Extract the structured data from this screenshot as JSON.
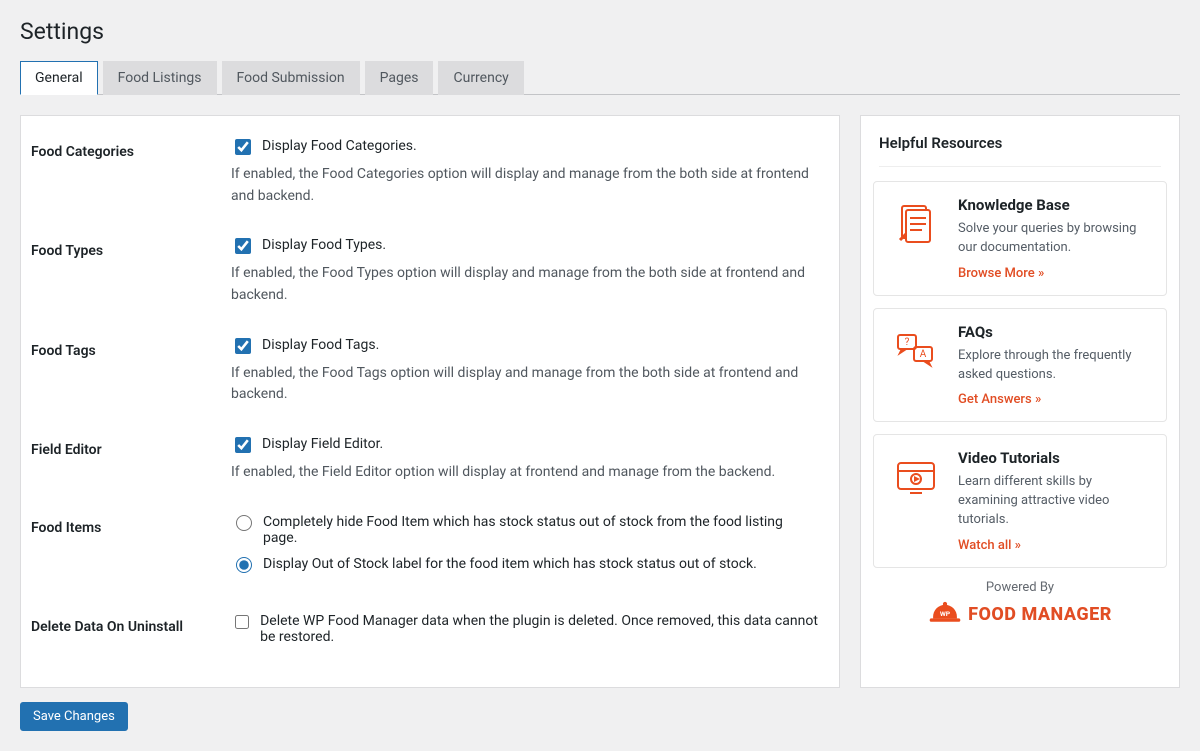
{
  "page_title": "Settings",
  "tabs": [
    "General",
    "Food Listings",
    "Food Submission",
    "Pages",
    "Currency"
  ],
  "active_tab": 0,
  "settings": [
    {
      "key": "food_categories",
      "label": "Food Categories",
      "type": "checkbox",
      "checked": true,
      "option_label": "Display Food Categories.",
      "description": "If enabled, the Food Categories option will display and manage from the both side at frontend and backend."
    },
    {
      "key": "food_types",
      "label": "Food Types",
      "type": "checkbox",
      "checked": true,
      "option_label": "Display Food Types.",
      "description": "If enabled, the Food Types option will display and manage from the both side at frontend and backend."
    },
    {
      "key": "food_tags",
      "label": "Food Tags",
      "type": "checkbox",
      "checked": true,
      "option_label": "Display Food Tags.",
      "description": "If enabled, the Food Tags option will display and manage from the both side at frontend and backend."
    },
    {
      "key": "field_editor",
      "label": "Field Editor",
      "type": "checkbox",
      "checked": true,
      "option_label": "Display Field Editor.",
      "description": "If enabled, the Field Editor option will display at frontend and manage from the backend."
    },
    {
      "key": "food_items",
      "label": "Food Items",
      "type": "radio",
      "selected": 1,
      "options": [
        "Completely hide Food Item which has stock status out of stock from the food listing page.",
        "Display Out of Stock label for the food item which has stock status out of stock."
      ]
    },
    {
      "key": "delete_data",
      "label": "Delete Data On Uninstall",
      "type": "checkbox",
      "checked": false,
      "option_label": "Delete WP Food Manager data when the plugin is deleted. Once removed, this data cannot be restored."
    }
  ],
  "save_button": "Save Changes",
  "sidebar": {
    "title": "Helpful Resources",
    "cards": [
      {
        "icon": "document-icon",
        "title": "Knowledge Base",
        "text": "Solve your queries by browsing our documentation.",
        "link_text": "Browse More »"
      },
      {
        "icon": "faq-icon",
        "title": "FAQs",
        "text": "Explore through the frequently asked questions.",
        "link_text": "Get Answers »"
      },
      {
        "icon": "video-icon",
        "title": "Video Tutorials",
        "text": "Learn different skills by examining attractive video tutorials.",
        "link_text": "Watch all »"
      }
    ],
    "powered_by": "Powered By",
    "logo_text": "FOOD MANAGER",
    "logo_badge": "WP"
  }
}
